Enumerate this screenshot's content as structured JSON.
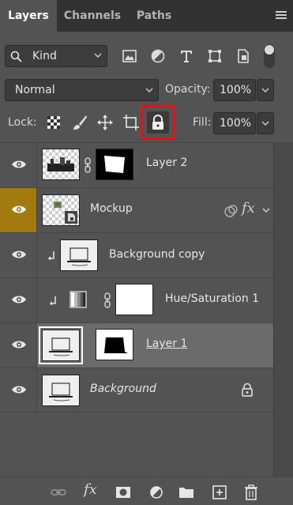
{
  "tabs": [
    {
      "label": "Layers",
      "active": true
    },
    {
      "label": "Channels",
      "active": false
    },
    {
      "label": "Paths",
      "active": false
    }
  ],
  "filter": {
    "kind_label": "Kind",
    "icons": [
      "image-filter-icon",
      "adjustment-filter-icon",
      "type-filter-icon",
      "shape-filter-icon",
      "smart-object-filter-icon"
    ],
    "toggle_on": true
  },
  "blend": {
    "mode": "Normal",
    "opacity_label": "Opacity:",
    "opacity_value": "100%"
  },
  "lock": {
    "label": "Lock:",
    "icons": [
      "lock-transparent-pixels-icon",
      "lock-image-pixels-icon",
      "lock-position-icon",
      "lock-artboard-icon",
      "lock-all-icon"
    ],
    "highlighted": "lock-all-icon",
    "highlight_color": "#e0131b",
    "fill_label": "Fill:",
    "fill_value": "100%"
  },
  "layers": [
    {
      "name": "Layer 2",
      "visible": true,
      "has_mask": true,
      "linked": true
    },
    {
      "name": "Mockup",
      "visible": true,
      "smart_object": true,
      "fx": "fx",
      "eye_highlight": "#a37a0f"
    },
    {
      "name": "Background copy",
      "visible": true,
      "clipped": true
    },
    {
      "name": "Hue/Saturation 1",
      "visible": true,
      "clipped": true,
      "adjustment": true,
      "linked": true
    },
    {
      "name": "Layer 1",
      "visible": true,
      "selected": true,
      "has_mask": true
    },
    {
      "name": "Background",
      "visible": true,
      "locked": true,
      "italic": true
    }
  ],
  "bottom_toolbar": [
    "link-layers-icon",
    "fx-icon",
    "add-mask-icon",
    "adjustment-layer-icon",
    "new-group-icon",
    "new-layer-icon",
    "delete-layer-icon"
  ],
  "bottom_fx_label": "fx"
}
